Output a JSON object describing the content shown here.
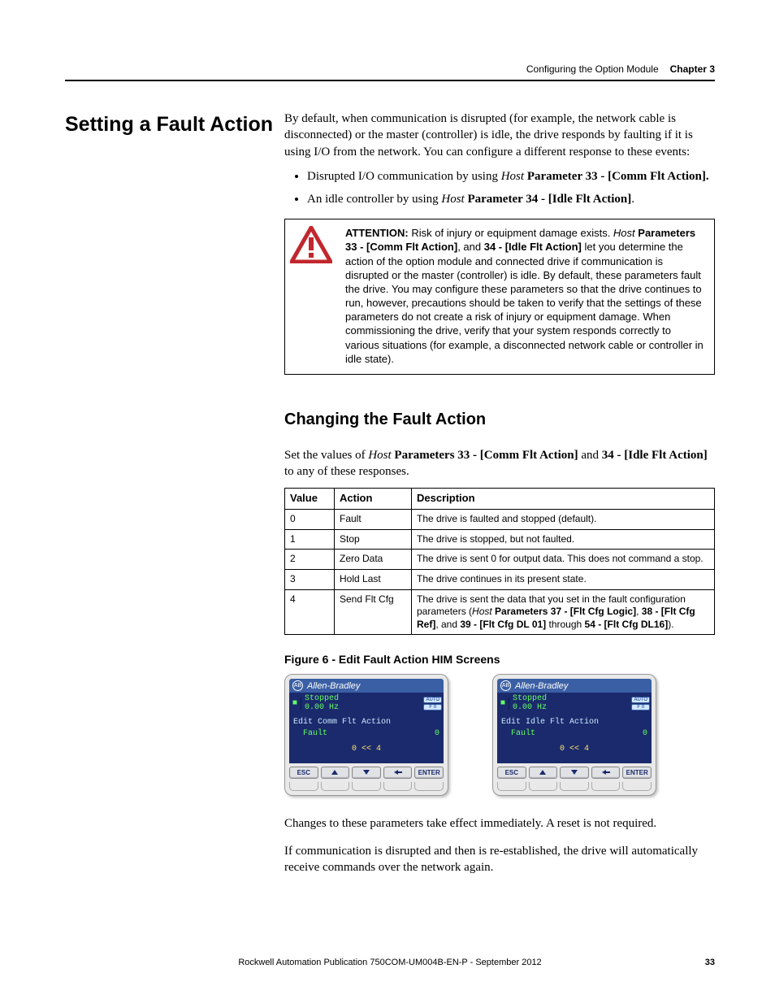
{
  "header": {
    "section": "Configuring the Option Module",
    "chapter": "Chapter 3"
  },
  "h1": "Setting a Fault Action",
  "intro": "By default, when communication is disrupted (for example, the network cable is disconnected) or the master (controller) is idle, the drive responds by faulting if it is using I/O from the network. You can configure a different response to these events:",
  "bullets": [
    {
      "pre": "Disrupted I/O communication by using ",
      "ital": "Host",
      "bold": " Parameter 33 - [Comm Flt Action]."
    },
    {
      "pre": "An idle controller by using ",
      "ital": "Host",
      "bold": " Parameter 34 - [Idle Flt Action]",
      "post": "."
    }
  ],
  "attention": {
    "label": "ATTENTION:",
    "lead": " Risk of injury or equipment damage exists. ",
    "ital1": "Host",
    "bold1": " Parameters 33 - [Comm Flt Action]",
    "mid": ", and ",
    "bold2": "34 - [Idle Flt Action]",
    "rest": " let you determine the action of the option module and connected drive if communication is disrupted or the master (controller) is idle. By default, these parameters fault the drive. You may configure these parameters so that the drive continues to run, however, precautions should be taken to verify that the settings of these parameters do not create a risk of injury or equipment damage. When commissioning the drive, verify that your system responds correctly to various situations (for example, a disconnected network cable or controller in idle state)."
  },
  "h2": "Changing the Fault Action",
  "change_intro_pre": "Set the values of ",
  "change_intro_ital": "Host",
  "change_intro_b1": " Parameters 33 - [Comm Flt Action]",
  "change_intro_mid": " and ",
  "change_intro_b2": "34 - [Idle Flt Action]",
  "change_intro_post": " to any of these responses.",
  "table": {
    "headers": [
      "Value",
      "Action",
      "Description"
    ],
    "rows": [
      {
        "v": "0",
        "a": "Fault",
        "d_plain": "The drive is faulted and stopped (default)."
      },
      {
        "v": "1",
        "a": "Stop",
        "d_plain": "The drive is stopped, but not faulted."
      },
      {
        "v": "2",
        "a": "Zero Data",
        "d_plain": "The drive is sent 0 for output data. This does not command a stop."
      },
      {
        "v": "3",
        "a": "Hold Last",
        "d_plain": "The drive continues in its present state."
      },
      {
        "v": "4",
        "a": "Send Flt Cfg",
        "d": {
          "p1": "The drive is sent the data that you set in the fault configuration parameters (",
          "ital": "Host",
          "b1": " Parameters 37 - [Flt Cfg Logic]",
          "c1": ", ",
          "b2": "38 - [Flt Cfg Ref]",
          "c2": ", and ",
          "b3": "39 - [Flt Cfg DL 01]",
          "c3": " through ",
          "b4": "54 - [Flt Cfg DL16]",
          "p2": ")."
        }
      }
    ]
  },
  "figure_caption": "Figure 6 - Edit Fault Action HIM Screens",
  "him": {
    "brand": "Allen-Bradley",
    "statusTitle": "Stopped",
    "statusSub": "0.00 Hz",
    "auto": "AUTO",
    "f0": "F 0",
    "range": "0  <<  4",
    "esc": "ESC",
    "enter": "ENTER",
    "screens": [
      {
        "title": "Edit Comm Flt Action",
        "valLabel": "Fault",
        "valNum": "0"
      },
      {
        "title": "Edit Idle Flt Action",
        "valLabel": "Fault",
        "valNum": "0"
      }
    ]
  },
  "outro1": "Changes to these parameters take effect immediately. A reset is not required.",
  "outro2": "If communication is disrupted and then is re-established, the drive will automatically receive commands over the network again.",
  "footer": {
    "pub": "Rockwell Automation Publication 750COM-UM004B-EN-P - September 2012",
    "page": "33"
  }
}
